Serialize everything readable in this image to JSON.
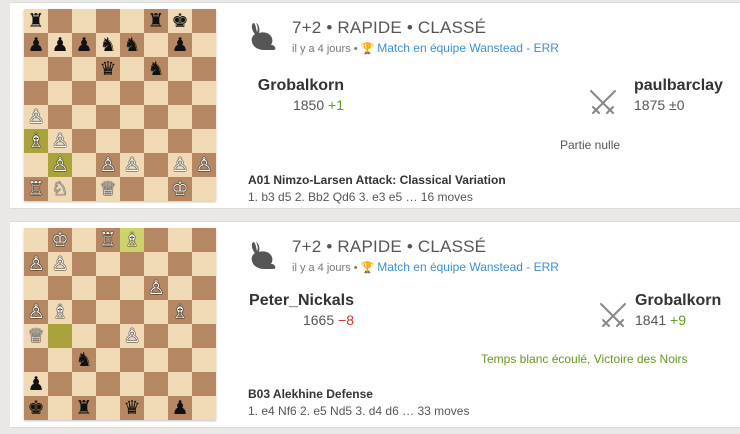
{
  "colors": {
    "light_square": "#f0d9b5",
    "dark_square": "#b58863",
    "highlight": "#cdd26a",
    "link": "#3b8fd6",
    "win": "#629924",
    "loss": "#cc3333"
  },
  "games": [
    {
      "board": [
        [
          "♜",
          "",
          "",
          "",
          "",
          "♜",
          "♚",
          ""
        ],
        [
          "♟",
          "♟",
          "♟",
          "♞",
          "♞",
          "",
          "♟",
          ""
        ],
        [
          "",
          "",
          "",
          "♛",
          "",
          "♞",
          "",
          ""
        ],
        [
          "",
          "",
          "",
          "",
          "",
          "",
          "",
          ""
        ],
        [
          "♙",
          "",
          "",
          "",
          "",
          "",
          "",
          ""
        ],
        [
          "♗",
          "♙",
          "",
          "",
          "",
          "",
          "",
          ""
        ],
        [
          "",
          "♙",
          "",
          "♙",
          "♙",
          "",
          "♙",
          "♙"
        ],
        [
          "♖",
          "♘",
          "",
          "♕",
          "",
          "",
          "♔",
          ""
        ]
      ],
      "highlights": [
        "5,0",
        "6,1"
      ],
      "speed": "7+2 • RAPIDE • CLASSÉ",
      "time_ago": "il y a 4 jours",
      "event_icon": "trophy-icon",
      "event": "Match en équipe Wanstead - ERR",
      "white": {
        "name": "Grobalkorn",
        "rating": "1850",
        "diff": "+1",
        "diff_type": "plus"
      },
      "black": {
        "name": "paulbarclay",
        "rating": "1875",
        "diff": "±0",
        "diff_type": "zero"
      },
      "result": "Partie nulle",
      "result_type": "draw",
      "opening": "A01 Nimzo-Larsen Attack: Classical Variation",
      "moves": "1. b3 d5 2. Bb2 Qd6 3. e3 e5 … 16 moves"
    },
    {
      "board": [
        [
          "",
          "♔",
          "",
          "♖",
          "♗",
          "",
          "",
          ""
        ],
        [
          "♙",
          "♙",
          "",
          "",
          "",
          "",
          "",
          ""
        ],
        [
          "",
          "",
          "",
          "",
          "",
          "♙",
          "",
          ""
        ],
        [
          "♙",
          "♗",
          "",
          "",
          "",
          "",
          "♗",
          ""
        ],
        [
          "♕",
          "",
          "",
          "",
          "♙",
          "",
          "",
          ""
        ],
        [
          "",
          "",
          "♞",
          "",
          "",
          "",
          "",
          ""
        ],
        [
          "♟",
          "",
          "",
          "",
          "",
          "",
          "",
          ""
        ],
        [
          "♚",
          "",
          "♜",
          "",
          "♛",
          "",
          "♟",
          ""
        ]
      ],
      "highlights": [
        "0,4",
        "4,1"
      ],
      "speed": "7+2 • RAPIDE • CLASSÉ",
      "time_ago": "il y a 4 jours",
      "event_icon": "trophy-icon",
      "event": "Match en équipe Wanstead - ERR",
      "white": {
        "name": "Peter_Nickals",
        "rating": "1665",
        "diff": "−8",
        "diff_type": "minus"
      },
      "black": {
        "name": "Grobalkorn",
        "rating": "1841",
        "diff": "+9",
        "diff_type": "plus"
      },
      "result": "Temps blanc écoulé, Victoire des Noirs",
      "result_type": "win",
      "opening": "B03 Alekhine Defense",
      "moves": "1. e4 Nf6 2. e5 Nd5 3. d4 d6 … 33 moves"
    }
  ]
}
